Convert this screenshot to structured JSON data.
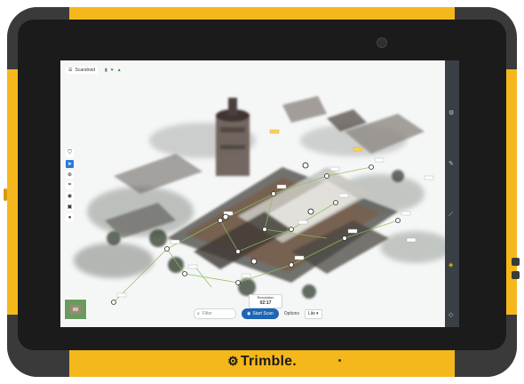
{
  "device": {
    "brand": "Trimble."
  },
  "app": {
    "title": "Scandroid",
    "title_icon": "list-icon",
    "status_icons": [
      "battery-icon",
      "location-icon",
      "signal-icon"
    ]
  },
  "left_toolbar": {
    "tools": [
      {
        "name": "shield-tool",
        "glyph": "⛉",
        "active": false
      },
      {
        "name": "select-tool",
        "glyph": "➤",
        "active": true
      },
      {
        "name": "measure-tool",
        "glyph": "⊕",
        "active": false
      },
      {
        "name": "crop-tool",
        "glyph": "⌗",
        "active": false
      },
      {
        "name": "layers-tool",
        "glyph": "◉",
        "active": false
      },
      {
        "name": "camera-tool",
        "glyph": "▣",
        "active": false
      },
      {
        "name": "point-tool",
        "glyph": "●",
        "active": false
      }
    ]
  },
  "bottom_bar": {
    "filter_placeholder": "Filter",
    "start_scan_label": "Start Scan",
    "options_label": "Options",
    "mode_value": "Lite",
    "scan_info_label": "Resolution",
    "scan_info_value": "02:17"
  },
  "colors": {
    "shell_yellow": "#f5b81c",
    "bezel": "#1b1b1b",
    "primary_button": "#1f64b5",
    "rail": "#3a3f46"
  }
}
